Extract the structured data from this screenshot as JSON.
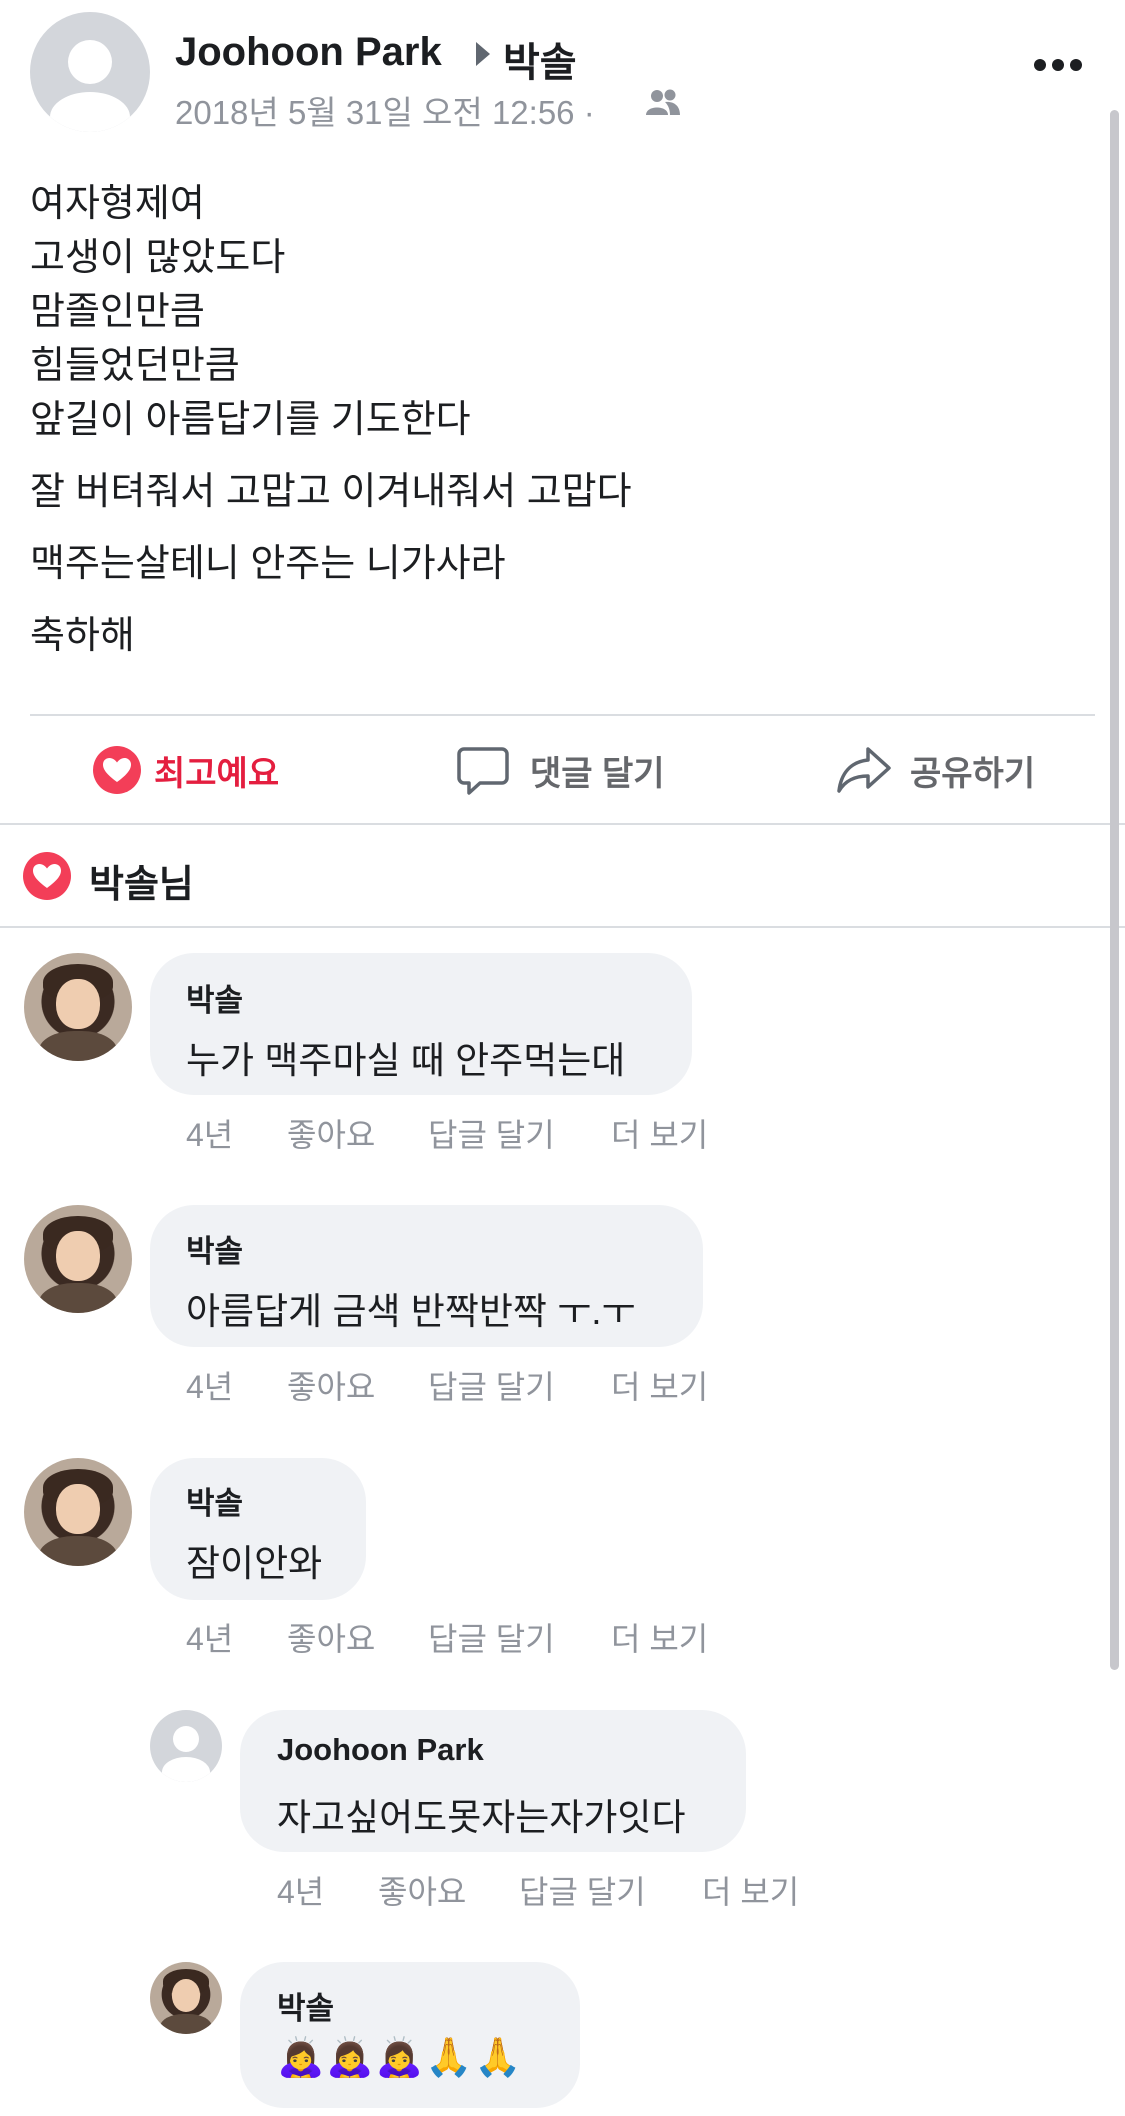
{
  "post": {
    "author": "Joohoon Park",
    "recipient": "박솔",
    "timestamp": "2018년 5월 31일 오전 12:56 ·",
    "lines": [
      "여자형제여",
      "고생이 많았도다",
      "맘졸인만큼",
      "힘들었던만큼",
      "앞길이 아름답기를 기도한다",
      "잘 버텨줘서 고맙고 이겨내줘서 고맙다",
      "맥주는살테니 안주는 니가사라",
      "축하해"
    ]
  },
  "actions": {
    "like": "최고예요",
    "comment": "댓글 달기",
    "share": "공유하기"
  },
  "reactions": {
    "summary": "박솔님"
  },
  "comment_actions": {
    "like": "좋아요",
    "reply": "답글 달기",
    "more": "더 보기"
  },
  "comments": [
    {
      "name": "박솔",
      "text": "누가 맥주마실 때 안주먹는대",
      "age": "4년"
    },
    {
      "name": "박솔",
      "text": "아름답게 금색 반짝반짝 ㅜ.ㅜ",
      "age": "4년"
    },
    {
      "name": "박솔",
      "text": "잠이안와",
      "age": "4년"
    }
  ],
  "replies": [
    {
      "name": "Joohoon Park",
      "text": "자고싶어도못자는자가잇다",
      "age": "4년"
    },
    {
      "name": "박솔",
      "text": "🙇‍♀️🙇‍♀️🙇‍♀️🙏🙏",
      "age": ""
    }
  ],
  "colors": {
    "love_red": "#f33e58",
    "love_text": "#e41e3f",
    "meta_gray": "#90949c",
    "bubble_bg": "#f0f2f5"
  }
}
